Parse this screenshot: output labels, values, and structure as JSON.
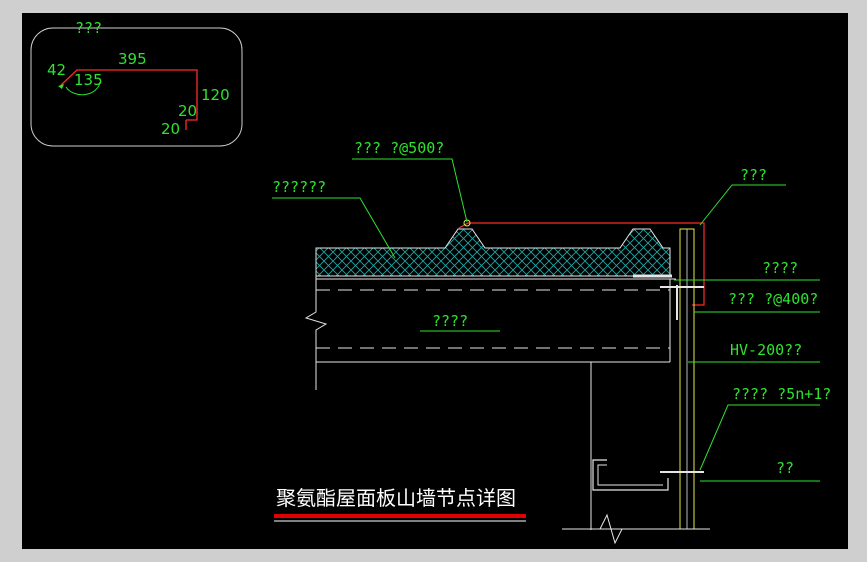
{
  "drawing": {
    "title": "聚氨酯屋面板山墙节点详图",
    "colors": {
      "background": "#000000",
      "frame": "#cfcfcf",
      "annotation": "#2ee22e",
      "flashing": "#ff2a2a",
      "structure": "#e6e6e6",
      "insulation": "#1fa3a3",
      "title": "#ffffff",
      "title_underline": "#e00000"
    }
  },
  "detail_inset": {
    "title": "???",
    "dims": {
      "d42": "42",
      "d135": "135",
      "d395": "395",
      "d120": "120",
      "d20a": "20",
      "d20b": "20"
    }
  },
  "callouts": {
    "screw_top": "??? ?@500?",
    "panel": "??????",
    "flashing": "???",
    "seal": "????",
    "screw_400": "??? ?@400?",
    "purlin_label": "????",
    "hv": "HV-200??",
    "screw_5n": "???? ?5n+1?",
    "wall": "??"
  }
}
